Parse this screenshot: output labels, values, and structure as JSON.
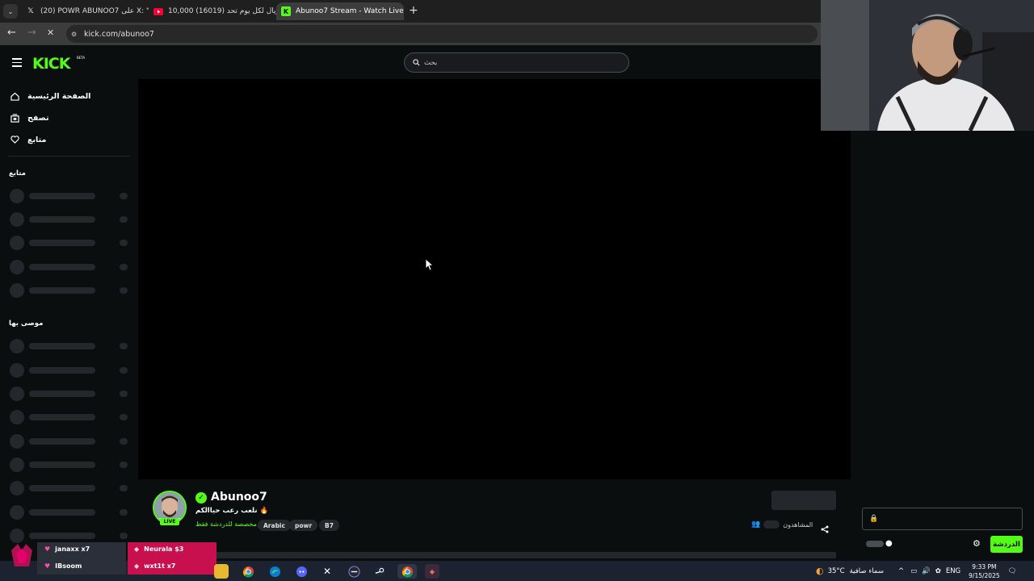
{
  "browser": {
    "tabs": [
      {
        "title": "(20) POWR ABUNOO7 على X: \"",
        "favicon": "x-logo"
      },
      {
        "title": "10,000 (16019) ريال لكل يوم تحد",
        "favicon": "youtube-logo"
      },
      {
        "title": "Abunoo7 Stream - Watch Live o",
        "favicon": "kick-logo"
      }
    ],
    "url": "kick.com/abunoo7",
    "new_tab_label": "+"
  },
  "kick": {
    "logo": "KICK",
    "beta": "BETA",
    "search_placeholder": "بحث",
    "nav": [
      {
        "label": "الصفحة الرئيسية",
        "icon": "home-icon"
      },
      {
        "label": "تصفح",
        "icon": "browse-icon"
      },
      {
        "label": "متابع",
        "icon": "heart-icon"
      }
    ],
    "following_header": "متابع",
    "recommended_header": "موصى بها"
  },
  "channel": {
    "name": "Abunoo7",
    "live": "LIVE",
    "title": "نلعب رعب حياالكم 🔥",
    "category": "مخصصة للدردشة فقط",
    "tags": [
      "Arabic",
      "powr",
      "B7"
    ],
    "viewers_label": "المشاهدون"
  },
  "chat": {
    "send_label": "الدردشة"
  },
  "overlay": {
    "donations": [
      "janaxx x7",
      "IBsoom",
      "Neurala $3",
      "wxt1t x7"
    ]
  },
  "system": {
    "temperature": "35°C",
    "weather": "سماء صافية",
    "lang": "ENG",
    "time": "9:33 PM",
    "date": "9/15/2025"
  },
  "colors": {
    "kick_green": "#53fc18",
    "background": "#0b0e0f"
  }
}
